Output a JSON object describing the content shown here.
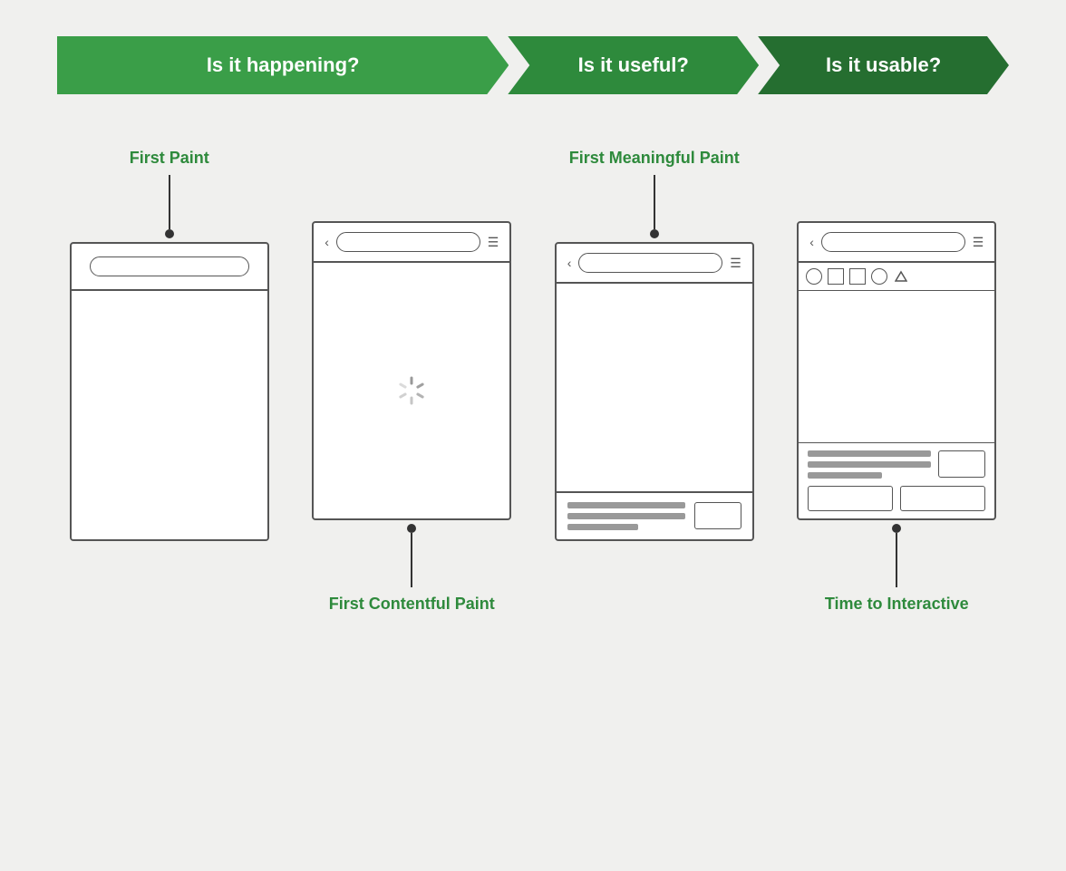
{
  "banner": {
    "arrow1": "Is it happening?",
    "arrow2": "Is it useful?",
    "arrow3": "Is it usable?"
  },
  "labels": {
    "first_paint": "First Paint",
    "first_contentful_paint": "First Contentful Paint",
    "first_meaningful_paint": "First Meaningful Paint",
    "time_to_interactive": "Time to Interactive"
  },
  "phones": {
    "p1_desc": "First Paint phone wireframe",
    "p2_desc": "First Contentful Paint phone wireframe with spinner",
    "p3_desc": "First Meaningful Paint phone wireframe with content",
    "p4_desc": "Time to Interactive phone wireframe fully interactive"
  }
}
